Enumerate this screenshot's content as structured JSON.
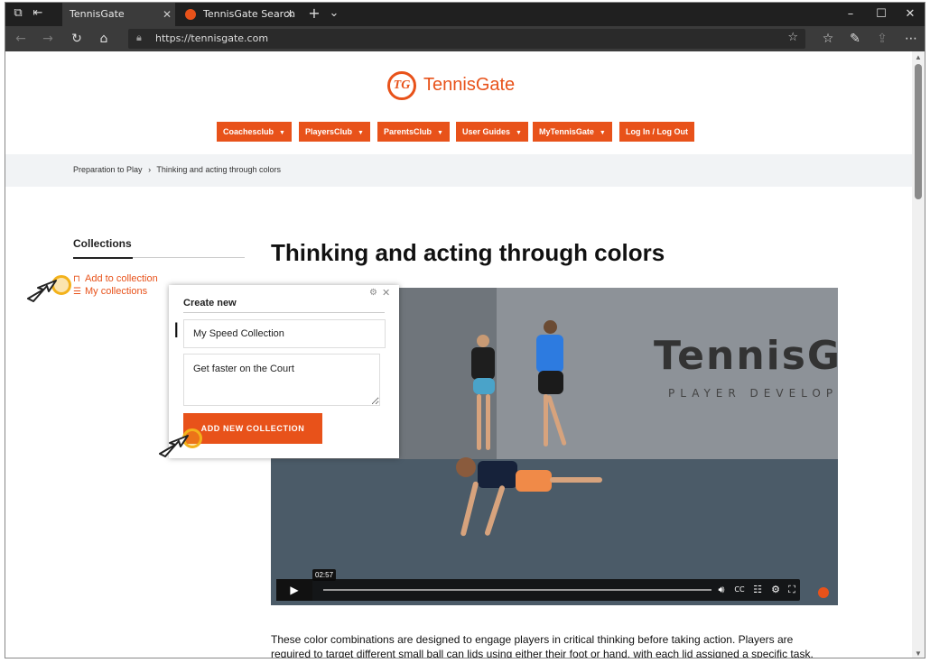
{
  "browser": {
    "tabs": [
      {
        "title": "TennisGate"
      },
      {
        "title": "TennisGate Search"
      }
    ],
    "url": "https://tennisgate.com",
    "icons": {
      "tab_actions": "tab-actions-icon",
      "back": "back-arrow-icon",
      "forward": "forward-arrow-icon",
      "refresh": "refresh-icon",
      "home": "home-icon",
      "lock": "lock-icon",
      "favorite": "star-icon"
    }
  },
  "site": {
    "logo_text": "TennisGate",
    "logo_mark": "TG",
    "accent": "#e8521a",
    "nav": [
      {
        "label": "Coachesclub",
        "dropdown": true
      },
      {
        "label": "PlayersClub",
        "dropdown": true
      },
      {
        "label": "ParentsClub",
        "dropdown": true
      },
      {
        "label": "User Guides",
        "dropdown": true
      },
      {
        "label": "MyTennisGate",
        "dropdown": true
      },
      {
        "label": "Log In / Log Out",
        "dropdown": false
      }
    ],
    "breadcrumb": [
      "Preparation to Play",
      "Thinking and acting through colors"
    ]
  },
  "sidebar": {
    "title": "Collections",
    "links": [
      {
        "label": "Add to collection",
        "icon": "bookmark-icon"
      },
      {
        "label": "My collections",
        "icon": "list-icon"
      }
    ]
  },
  "article": {
    "title": "Thinking and acting through colors",
    "text": "These color combinations are designed to engage players in critical thinking before taking action. Players are required to target different small ball can lids using either their foot or hand, with each lid assigned a specific task."
  },
  "video": {
    "brand": "TennisG",
    "brand_sub": "PLAYER DEVELOPM",
    "time": "02:57"
  },
  "popup": {
    "title": "Create new",
    "name_value": "My Speed Collection",
    "description_value": "Get faster on the Court",
    "button_label": "ADD NEW COLLECTION"
  }
}
